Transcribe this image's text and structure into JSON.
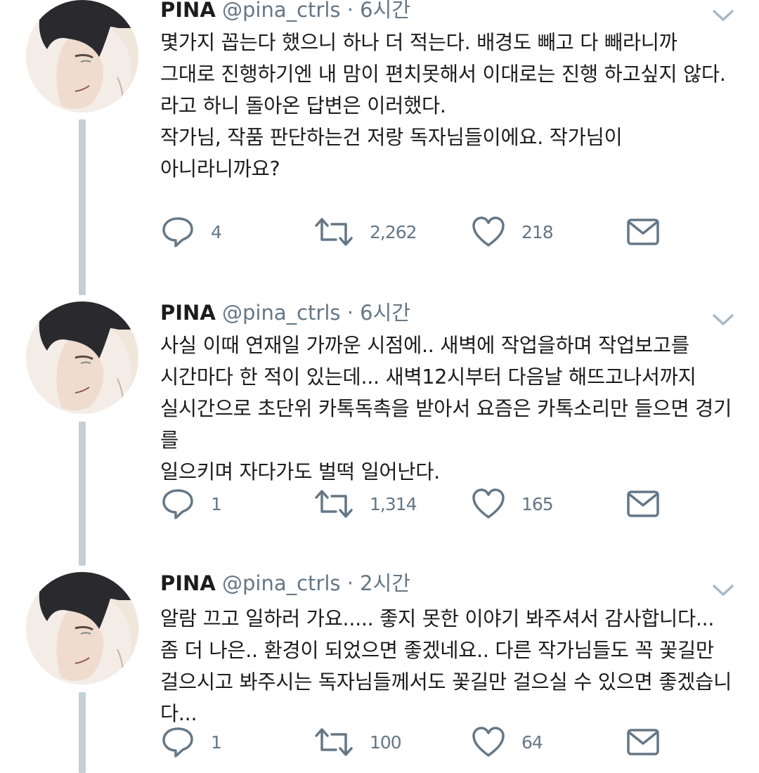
{
  "tweets": [
    {
      "name": "PINA",
      "handle": "@pina_ctrls",
      "separator": "·",
      "time": "6시간",
      "text": "몇가지 꼽는다 했으니 하나 더 적는다. 배경도 빼고 다 빼라니까\n그대로 진행하기엔 내 맘이 편치못해서 이대로는 진행 하고싶지 않다.\n라고 하니 돌아온 답변은 이러했다.\n작가님, 작품 판단하는건 저랑 독자님들이에요. 작가님이\n아니라니까요?",
      "replies": "4",
      "retweets": "2,262",
      "likes": "218"
    },
    {
      "name": "PINA",
      "handle": "@pina_ctrls",
      "separator": "·",
      "time": "6시간",
      "text": "사실 이때 연재일 가까운 시점에.. 새벽에 작업을하며 작업보고를\n시간마다 한 적이 있는데... 새벽12시부터 다음날 해뜨고나서까지\n실시간으로 초단위 카톡독촉을 받아서 요즘은 카톡소리만 들으면 경기를\n일으키며 자다가도 벌떡 일어난다.",
      "replies": "1",
      "retweets": "1,314",
      "likes": "165"
    },
    {
      "name": "PINA",
      "handle": "@pina_ctrls",
      "separator": "·",
      "time": "2시간",
      "text": "알람 끄고 일하러 가요..... 좋지 못한 이야기 봐주셔서 감사합니다...\n좀 더 나은.. 환경이 되었으면 좋겠네요.. 다른 작가님들도 꼭 꽃길만\n걸으시고 봐주시는 독자님들께서도 꽃길만 걸으실 수 있으면 좋겠습니다...",
      "replies": "1",
      "retweets": "100",
      "likes": "64"
    }
  ],
  "icons": {
    "reply": "reply-icon",
    "retweet": "retweet-icon",
    "like": "heart-icon",
    "dm": "envelope-icon",
    "menu": "chevron-down-icon"
  },
  "colors": {
    "icon": "#657786",
    "thread_line": "#c4cfd6",
    "text": "#1c1c1c"
  }
}
